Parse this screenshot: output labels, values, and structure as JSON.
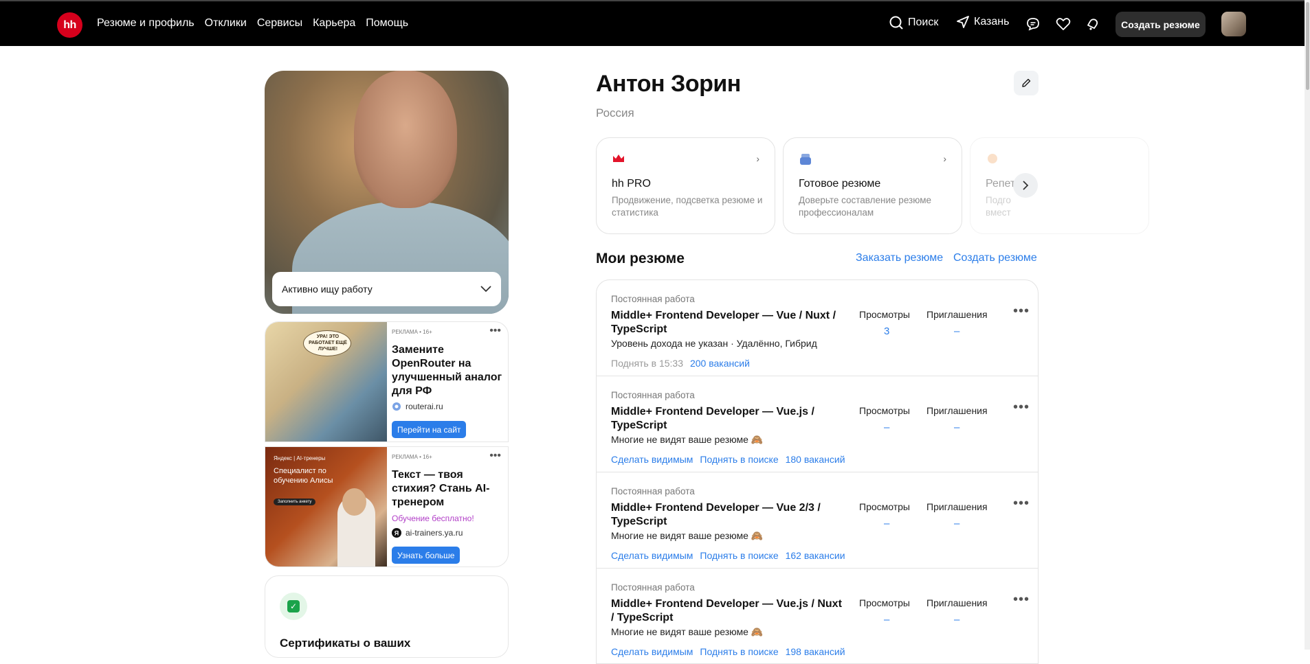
{
  "header": {
    "logo": "hh",
    "nav": [
      "Резюме и профиль",
      "Отклики",
      "Сервисы",
      "Карьера",
      "Помощь"
    ],
    "search": "Поиск",
    "city": "Казань",
    "create_resume": "Создать резюме"
  },
  "profile": {
    "name": "Антон Зорин",
    "country": "Россия",
    "job_status": "Активно ищу работу"
  },
  "services": [
    {
      "title": "hh PRO",
      "desc": "Продвижение, подсветка резюме и статистика"
    },
    {
      "title": "Готовое резюме",
      "desc": "Доверьте составление резюме профессионалам"
    },
    {
      "title": "Репет",
      "desc": "Подго вмест"
    }
  ],
  "ads": [
    {
      "meta": "РЕКЛАМА • 16+",
      "title": "Замените OpenRouter на улучшенный аналог для РФ",
      "domain": "routerai.ru",
      "cta": "Перейти на сайт",
      "img_text": "УРА! ЭТО РАБОТАЕТ ЕЩЁ ЛУЧШЕ!"
    },
    {
      "meta": "РЕКЛАМА • 16+",
      "title": "Текст — твоя стихия? Стань AI-тренером",
      "free": "Обучение бесплатно!",
      "domain": "ai-trainers.ya.ru",
      "cta": "Узнать больше",
      "img_brand": "Яндекс | AI-тренеры",
      "img_title": "Специалист по обучению Алисы",
      "img_btn": "Заполнить анкету"
    }
  ],
  "certificate": {
    "title": "Сертификаты о ваших"
  },
  "resumes_section": {
    "title": "Мои резюме",
    "order": "Заказать резюме",
    "create": "Создать резюме",
    "views_label": "Просмотры",
    "invites_label": "Приглашения"
  },
  "resumes": [
    {
      "type": "Постоянная работа",
      "title": "Middle+ Frontend Developer — Vue / Nuxt / TypeScript",
      "sub": "Уровень дохода не указан · Удалённо, Гибрид",
      "views": "3",
      "invites": "–",
      "actions": [
        "Поднять в 15:33",
        "200 вакансий"
      ]
    },
    {
      "type": "Постоянная работа",
      "title": "Middle+ Frontend Developer — Vue.js / TypeScript",
      "sub": "Многие не видят ваше резюме 🙈",
      "views": "–",
      "invites": "–",
      "actions": [
        "Сделать видимым",
        "Поднять в поиске",
        "180 вакансий"
      ]
    },
    {
      "type": "Постоянная работа",
      "title": "Middle+ Frontend Developer — Vue 2/3 / TypeScript",
      "sub": "Многие не видят ваше резюме 🙈",
      "views": "–",
      "invites": "–",
      "actions": [
        "Сделать видимым",
        "Поднять в поиске",
        "162 вакансии"
      ]
    },
    {
      "type": "Постоянная работа",
      "title": "Middle+ Frontend Developer — Vue.js / Nuxt / TypeScript",
      "sub": "Многие не видят ваше резюме 🙈",
      "views": "–",
      "invites": "–",
      "actions": [
        "Сделать видимым",
        "Поднять в поиске",
        "198 вакансий"
      ]
    }
  ],
  "colors": {
    "brand": "#d6001c",
    "link": "#2b7de9"
  }
}
